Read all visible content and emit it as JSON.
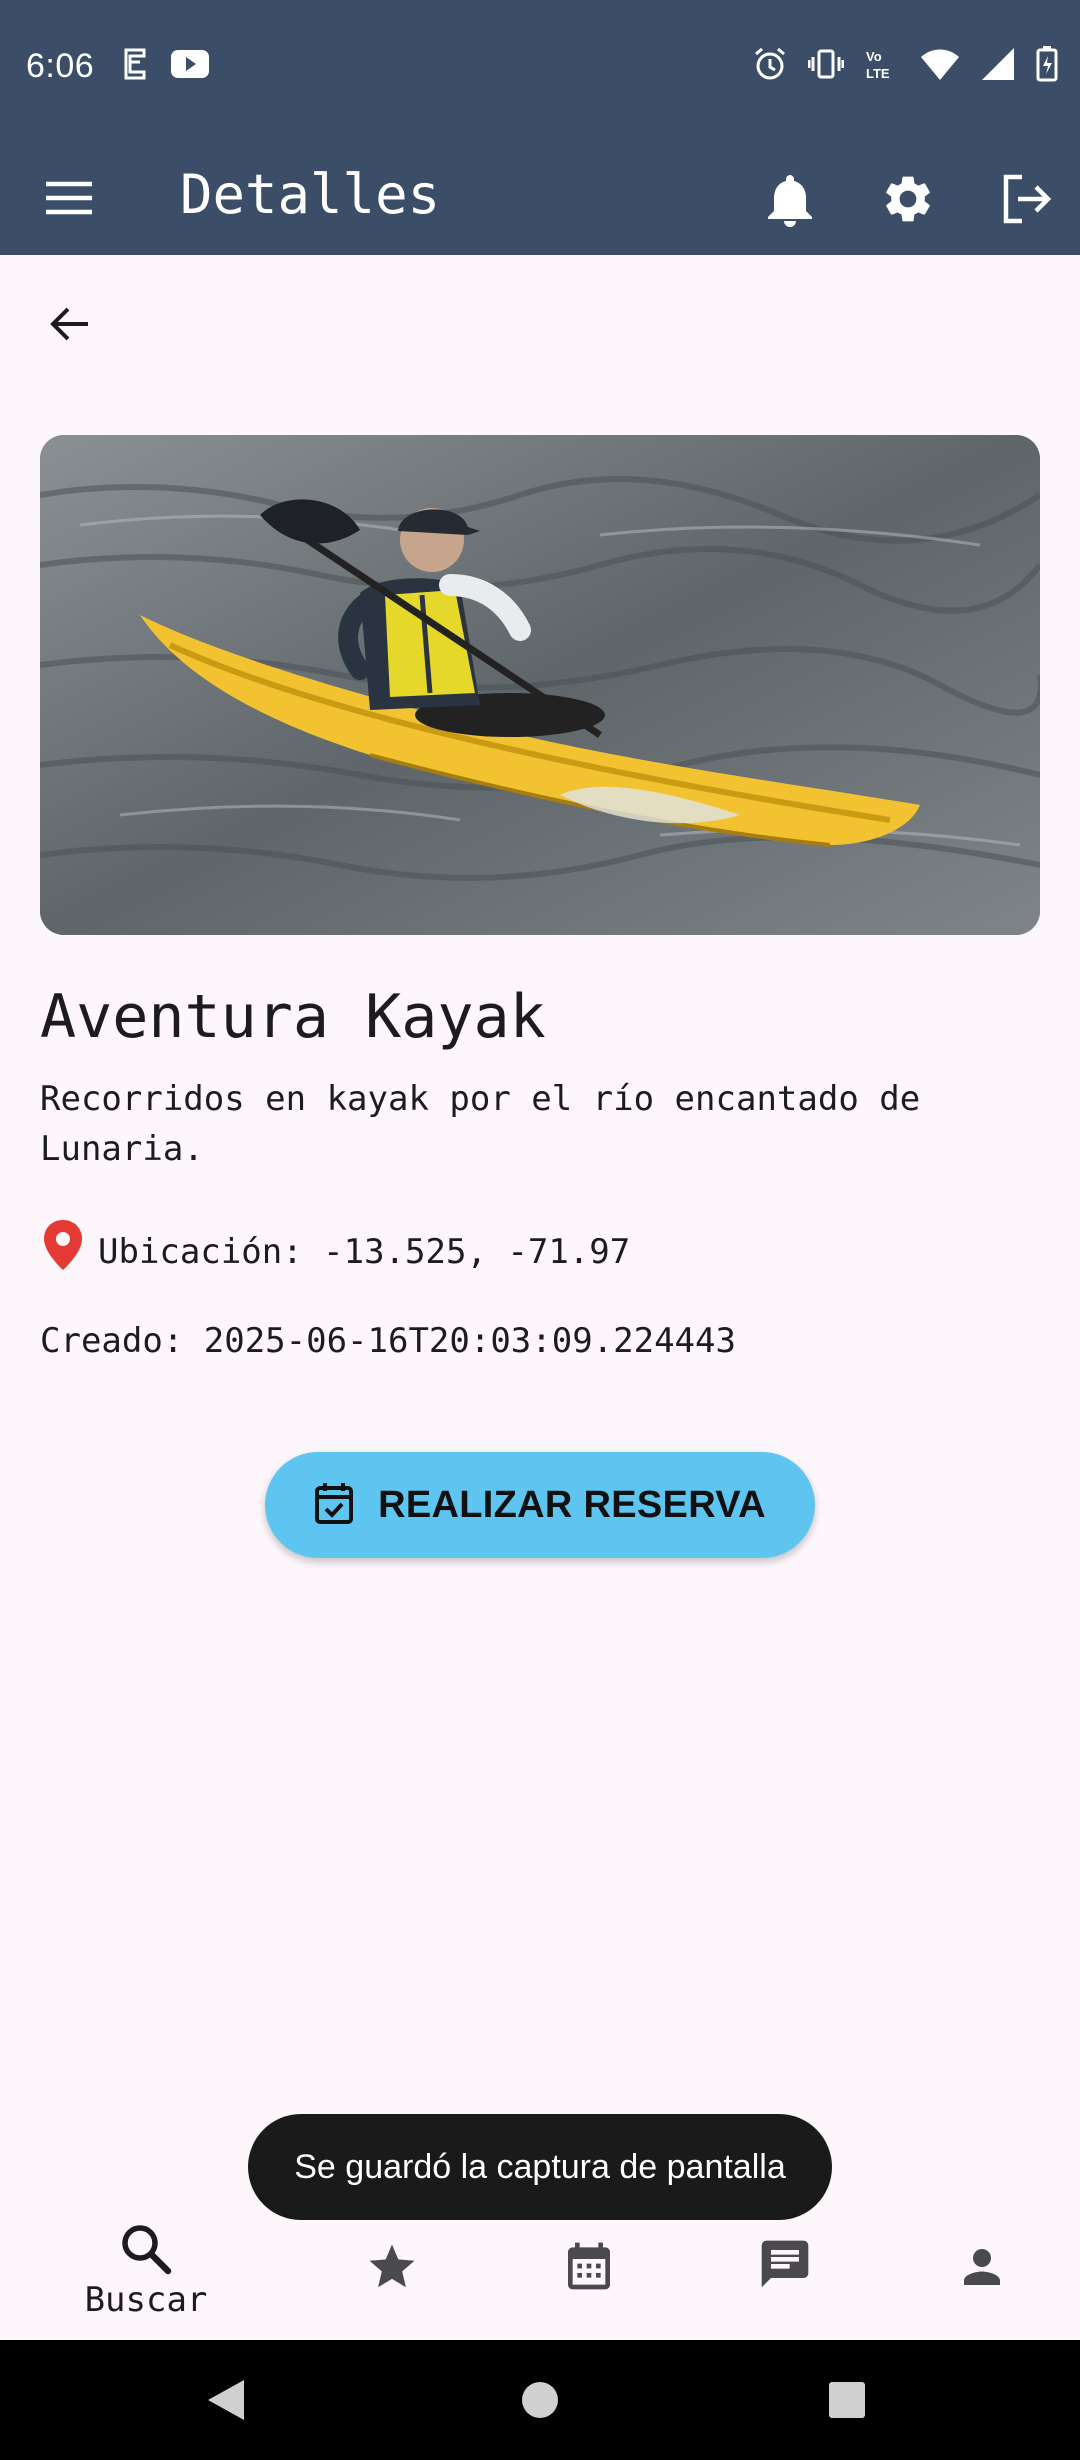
{
  "status_bar": {
    "time": "6:06",
    "icons": [
      "screen-record-icon",
      "youtube-icon",
      "alarm-icon",
      "vibrate-icon",
      "volte-icon",
      "wifi-icon",
      "signal-icon",
      "battery-charging-icon"
    ]
  },
  "app_bar": {
    "title": "Detalles",
    "icons": [
      "menu-icon",
      "bell-icon",
      "gear-icon",
      "logout-icon"
    ]
  },
  "detail": {
    "image_description_icon": "kayak-photo",
    "title": "Aventura Kayak",
    "description": "Recorridos en kayak por el río encantado de Lunaria.",
    "location": "Ubicación: -13.525, -71.97",
    "created": "Creado: 2025-06-16T20:03:09.224443"
  },
  "reserve_button": {
    "label": "REALIZAR RESERVA",
    "icon": "calendar-check-icon"
  },
  "toast": {
    "text": "Se guardó la captura de pantalla"
  },
  "bottom_nav": {
    "items": [
      {
        "label": "Buscar",
        "icon": "search-icon",
        "active": true
      },
      {
        "label": "",
        "icon": "star-icon"
      },
      {
        "label": "",
        "icon": "calendar-icon"
      },
      {
        "label": "",
        "icon": "chat-icon"
      },
      {
        "label": "",
        "icon": "person-icon"
      }
    ]
  },
  "colors": {
    "app_bar": "#3B4D67",
    "background": "#FDF7FC",
    "accent_button": "#5EC4F0",
    "location_pin": "#E53935",
    "toast": "#1A1A1A"
  }
}
